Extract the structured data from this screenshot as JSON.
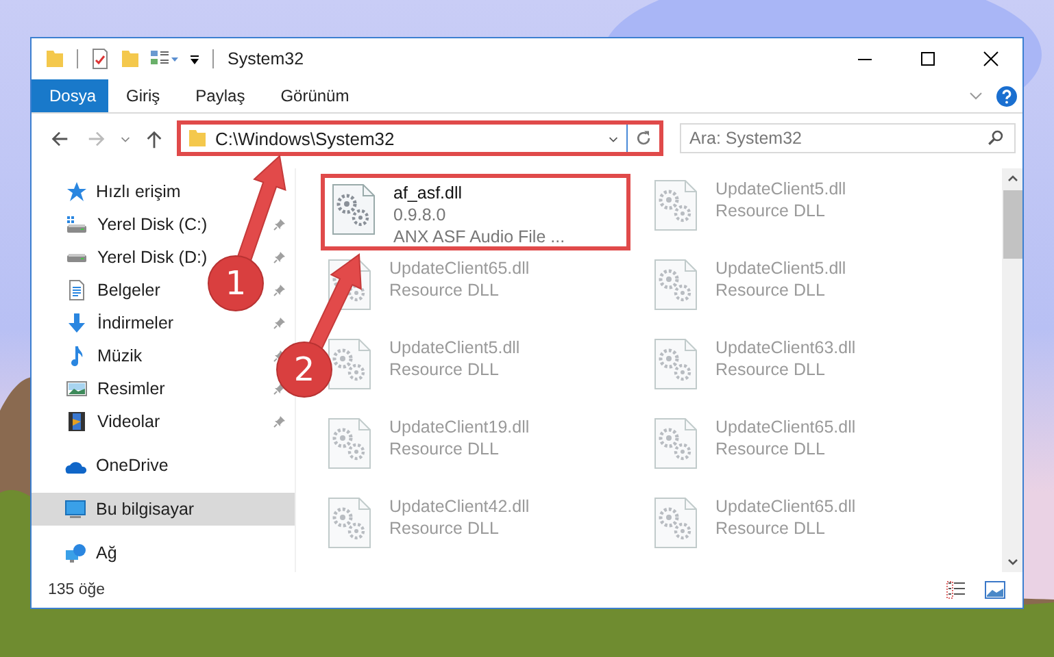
{
  "window": {
    "title": "System32"
  },
  "ribbon": {
    "tabs": [
      {
        "label": "Dosya",
        "selected": true
      },
      {
        "label": "Giriş",
        "selected": false
      },
      {
        "label": "Paylaş",
        "selected": false
      },
      {
        "label": "Görünüm",
        "selected": false
      }
    ]
  },
  "address_bar": {
    "path": "C:\\Windows\\System32",
    "highlighted": true
  },
  "search": {
    "placeholder": "Ara: System32"
  },
  "sidebar": {
    "items": [
      {
        "label": "Hızlı erişim",
        "kind": "quick",
        "selected": false,
        "children": [
          {
            "label": "Yerel Disk (C:)",
            "kind": "drive-c",
            "pinned": true,
            "selected": false
          },
          {
            "label": "Yerel Disk (D:)",
            "kind": "drive",
            "pinned": true,
            "selected": false
          },
          {
            "label": "Belgeler",
            "kind": "document",
            "pinned": true,
            "selected": false
          },
          {
            "label": "İndirmeler",
            "kind": "download",
            "pinned": true,
            "selected": false
          },
          {
            "label": "Müzik",
            "kind": "music",
            "pinned": true,
            "selected": false
          },
          {
            "label": "Resimler",
            "kind": "pictures",
            "pinned": true,
            "selected": false
          },
          {
            "label": "Videolar",
            "kind": "video",
            "pinned": true,
            "selected": false
          }
        ]
      },
      {
        "label": "OneDrive",
        "kind": "cloud",
        "selected": false
      },
      {
        "label": "Bu bilgisayar",
        "kind": "computer",
        "selected": true
      },
      {
        "label": "Ağ",
        "kind": "network",
        "selected": false
      }
    ]
  },
  "files": [
    {
      "name": "af_asf.dll",
      "lines": [
        "0.9.8.0",
        "ANX ASF Audio File ..."
      ],
      "highlighted": true,
      "blurred": false
    },
    {
      "name": "UpdateClient5.dll",
      "lines": [
        "Resource DLL"
      ],
      "highlighted": false,
      "blurred": true
    },
    {
      "name": "UpdateClient65.dll",
      "lines": [
        "Resource DLL"
      ],
      "highlighted": false,
      "blurred": true
    },
    {
      "name": "UpdateClient5.dll",
      "lines": [
        "Resource DLL"
      ],
      "highlighted": false,
      "blurred": true
    },
    {
      "name": "UpdateClient5.dll",
      "lines": [
        "Resource DLL"
      ],
      "highlighted": false,
      "blurred": true
    },
    {
      "name": "UpdateClient63.dll",
      "lines": [
        "Resource DLL"
      ],
      "highlighted": false,
      "blurred": true
    },
    {
      "name": "UpdateClient19.dll",
      "lines": [
        "Resource DLL"
      ],
      "highlighted": false,
      "blurred": true
    },
    {
      "name": "UpdateClient65.dll",
      "lines": [
        "Resource DLL"
      ],
      "highlighted": false,
      "blurred": true
    },
    {
      "name": "UpdateClient42.dll",
      "lines": [
        "Resource DLL"
      ],
      "highlighted": false,
      "blurred": true
    },
    {
      "name": "UpdateClient65.dll",
      "lines": [
        "Resource DLL"
      ],
      "highlighted": false,
      "blurred": true
    }
  ],
  "status_bar": {
    "count": "135 öğe"
  },
  "callouts": [
    {
      "label": "1"
    },
    {
      "label": "2"
    }
  ]
}
